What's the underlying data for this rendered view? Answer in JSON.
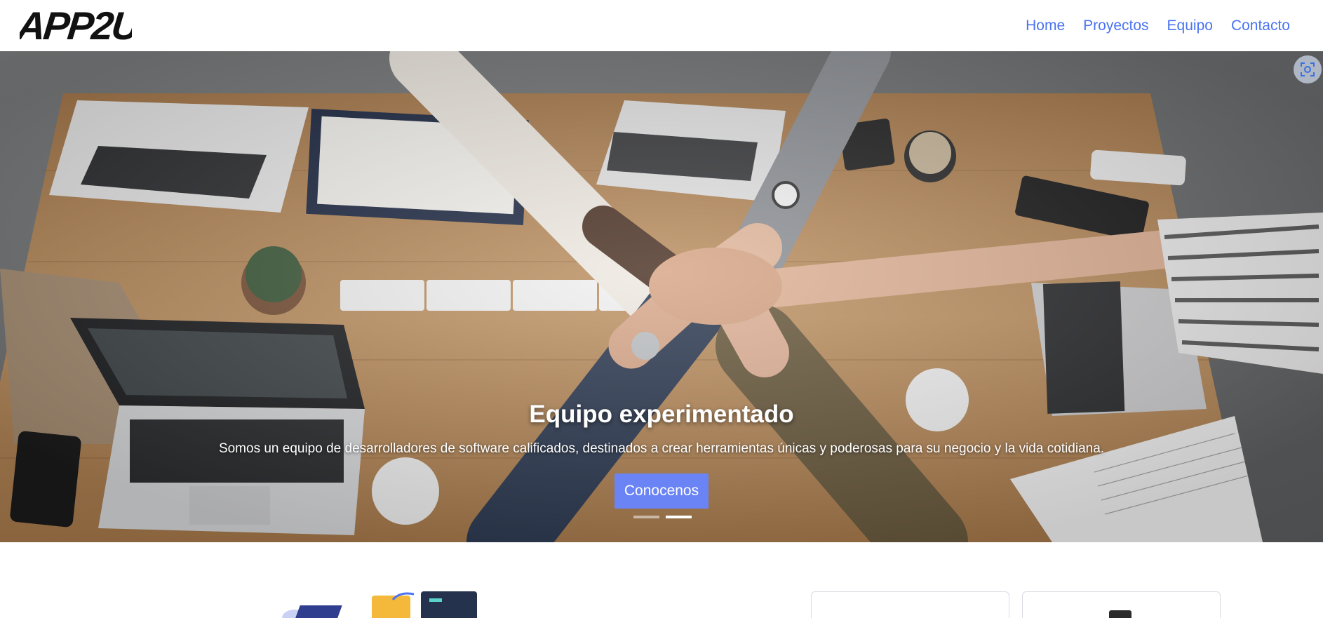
{
  "brand": {
    "logo_text": "APP2U"
  },
  "nav": {
    "items": [
      "Home",
      "Proyectos",
      "Equipo",
      "Contacto"
    ]
  },
  "hero": {
    "title": "Equipo experimentado",
    "description": "Somos un equipo de desarrolladores de software calificados, destinados a crear herramientas únicas y poderosas para su negocio y la vida cotidiana.",
    "cta_label": "Conocenos",
    "active_slide": 2,
    "slide_count": 2,
    "image_subject": "team hands stacked over wooden table with laptops"
  },
  "colors": {
    "nav_link": "#4a73f2",
    "cta": "#6b84f5",
    "wood": "#b98a57"
  }
}
